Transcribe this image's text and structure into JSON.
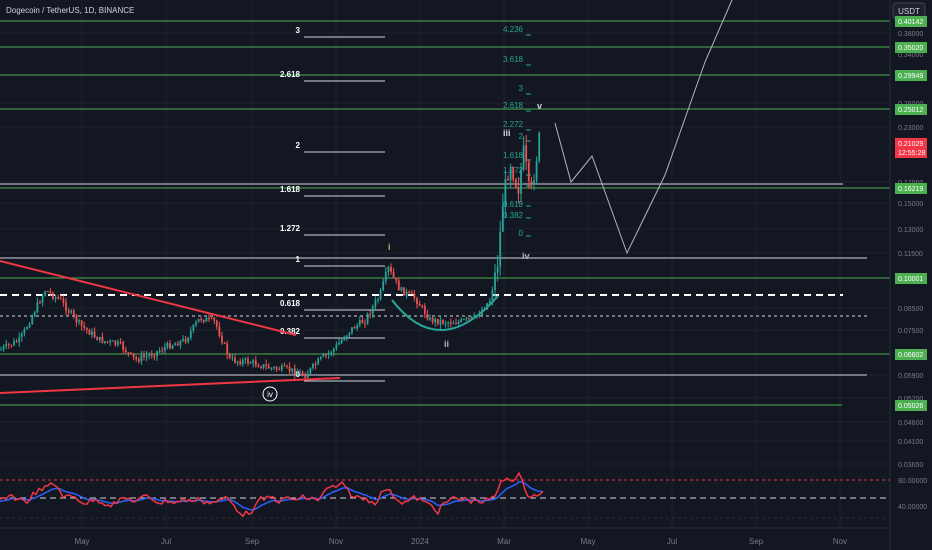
{
  "header": {
    "symbol_label": "Dogecoin / TetherUS, 1D, BINANCE",
    "currency_button": "USDT"
  },
  "colors": {
    "bg": "#131722",
    "green": "#4caf50",
    "red": "#f23645",
    "blue": "#2962ff",
    "teal": "#26a69a",
    "fib_white": "#d1d4dc",
    "text": "#b2b5be",
    "wave": "#c9a961"
  },
  "price_axis": {
    "ticks": [
      "0.40142",
      "0.38000",
      "0.35020",
      "0.34000",
      "0.29949",
      "0.26000",
      "0.25012",
      "0.23000",
      "0.21029",
      "0.17000",
      "0.16219",
      "0.15000",
      "0.13000",
      "0.11500",
      "0.10001",
      "0.08500",
      "0.07500",
      "0.06602",
      "0.05900",
      "0.05200",
      "0.05026",
      "0.04600",
      "0.04100",
      "0.03650"
    ],
    "green_labels": [
      "0.40142",
      "0.35020",
      "0.29949",
      "0.25012",
      "0.16219",
      "0.10001",
      "0.06602",
      "0.05026"
    ],
    "current_price": "0.21029",
    "countdown": "12:55:28"
  },
  "time_axis": {
    "labels": [
      "May",
      "Jul",
      "Sep",
      "Nov",
      "2024",
      "Mar",
      "May",
      "Jul",
      "Sep",
      "Nov"
    ]
  },
  "rsi": {
    "upper_label": "80.00000",
    "lower_label": "40.00000"
  },
  "fib_left": {
    "levels": [
      "3",
      "2.618",
      "2",
      "1.618",
      "1.272",
      "1",
      "0.618",
      "0.382",
      "0"
    ]
  },
  "fib_right": {
    "levels": [
      "4.236",
      "3.618",
      "3",
      "2.618",
      "2.272",
      "2",
      "1.618",
      "1.272",
      "1",
      "0.618",
      "0.382",
      "0"
    ]
  },
  "waves": {
    "w1": "i",
    "w2": "ii",
    "w3": "iii",
    "w4": "iv",
    "w5": "v",
    "old_w4": "iv"
  }
}
